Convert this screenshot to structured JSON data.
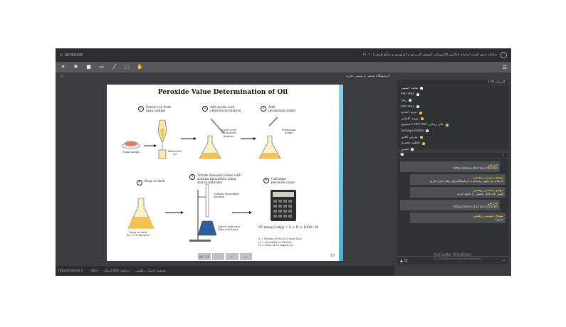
{
  "titlebar": {
    "brand": "SKYROOM",
    "meeting_title": "سامانه درس افزار (سامانه یادگیری الکترونیکی آموزش کاربردی و کشاورزی و منابع طبیعی) - ۱۴۰۱"
  },
  "toolbar": {
    "tools": [
      {
        "name": "share-icon",
        "glyph": "✶"
      },
      {
        "name": "mic-icon",
        "glyph": "✱"
      },
      {
        "name": "camera-icon",
        "glyph": "■"
      },
      {
        "name": "screen-icon",
        "glyph": "▭"
      },
      {
        "name": "pen-icon",
        "glyph": "╱"
      },
      {
        "name": "file-icon",
        "glyph": "⬚"
      },
      {
        "name": "hand-icon",
        "glyph": "✋"
      }
    ],
    "menu_glyph": "☰"
  },
  "stage": {
    "title": "آزمایشگاه شیمی و شیمی تجزیه",
    "panel_glyph": "▢"
  },
  "slide": {
    "title": "Peroxide Value Determination of Oil",
    "steps": [
      {
        "num": "1",
        "text": "Extract oil from\ntuna sample"
      },
      {
        "num": "2",
        "text": "Add acetic acid-\nchloroform mixture"
      },
      {
        "num": "3",
        "text": "Add\npotassium iodide"
      },
      {
        "num": "4",
        "text": "Keep in dark"
      },
      {
        "num": "5",
        "text": "Titrate released iodine with\nsodium thiosulfate using\nstarch indicator"
      },
      {
        "num": "6",
        "text": "Calculate\nperoxide value"
      }
    ],
    "labels": {
      "tuna": "Tuna sample",
      "extracted": "Extracted\noil",
      "acetic": "Acetic acid-\nchloroform\nmixture",
      "ki": "Potassium\niodide",
      "dark": "Keep in dark\nfor 5-10 minutes",
      "thio": "Sodium thiosulfate\nsolution",
      "starch": "Starch indicator\n(blue solution)"
    },
    "formula": "PV (meq O₂/kg) = S × N × 1000 / W",
    "legend": [
      "S = Volume of Na₂S₂O₃ used (mL)",
      "N = Normality of Na₂S₂O₃",
      "W = Mass of oil sample (g)"
    ],
    "page_number": "59",
    "colors": {
      "accent": "#4fb0d8",
      "oil": "#f2c34e",
      "starch": "#2f5f9a"
    }
  },
  "stage_controls": [
    "48 / 59",
    "–",
    "+",
    "⤢"
  ],
  "status": {
    "url": "http://shcircle.ir",
    "stats": "۰ kb/s ارسال · ۰ kb/s دریافت",
    "network": "وضعیت اتصال: مطلوب"
  },
  "users": {
    "title": "کاربران (۱۴)",
    "list": [
      {
        "name": "محمد حسینی",
        "gold": false
      },
      {
        "name": "۹۹۳۱۲۴۵۲",
        "gold": false
      },
      {
        "name": "زهرا",
        "gold": false
      },
      {
        "name": "۹۹۳۱۲۴۷۸",
        "gold": false
      },
      {
        "name": "مریم احمدی",
        "gold": true
      },
      {
        "name": "مهدی کاظمی",
        "gold": true
      },
      {
        "name": "علی رضایی ۹۹۳۱۲۴۵۷ دانشجوی",
        "gold": true
      },
      {
        "name": "Somaye Fatehi",
        "gold": false
      },
      {
        "name": "مدرس کلاس",
        "gold": true
      },
      {
        "name": "فاطمه محمدی",
        "gold": true
      },
      {
        "name": "حسین",
        "gold": false
      }
    ]
  },
  "chat": {
    "header_glyph": "💬",
    "messages": [
      {
        "who": "مدرس",
        "text": "https://drive.shcircle.ir/f/3184",
        "kind": "other"
      },
      {
        "who": "مهدی حسینی رفیعی",
        "text": "با سلام من هنوز نرسیدم به آزمایشگاه ولی وقت دارم امروز",
        "kind": "mine"
      },
      {
        "who": "مهدی حسینی رفیعی",
        "text": "همین الان فایل تکمیلی را دانلود کردم",
        "kind": "mine"
      },
      {
        "who": "مدرس",
        "text": "https://drive.shcircle.ir/f/3185",
        "kind": "other"
      },
      {
        "who": "مهدی حسینی رفیعی",
        "text": "ممنون",
        "kind": "mine"
      }
    ],
    "input_left": "▲ ☺",
    "input_right": "⋯"
  },
  "watermark": {
    "line1": "Activate Windows",
    "line2": "Go to Settings to activate Windows."
  }
}
